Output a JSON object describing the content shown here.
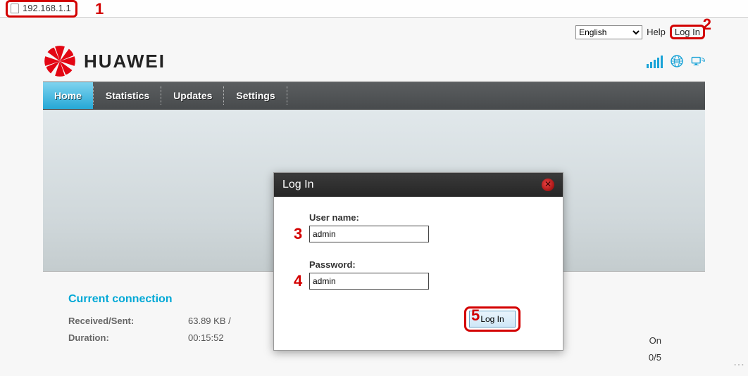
{
  "addressbar": {
    "url": "192.168.1.1"
  },
  "annotations": {
    "n1": "1",
    "n2": "2",
    "n3": "3",
    "n4": "4",
    "n5": "5"
  },
  "top": {
    "language_selected": "English",
    "help": "Help",
    "login": "Log In"
  },
  "brand": {
    "name": "HUAWEI"
  },
  "nav": {
    "items": [
      {
        "label": "Home",
        "active": true
      },
      {
        "label": "Statistics",
        "active": false
      },
      {
        "label": "Updates",
        "active": false
      },
      {
        "label": "Settings",
        "active": false
      }
    ]
  },
  "stats": {
    "title": "Current connection",
    "rows": [
      {
        "label": "Received/Sent:",
        "value": "63.89 KB /"
      },
      {
        "label": "Duration:",
        "value": "00:15:52"
      }
    ],
    "right": {
      "status": "On",
      "count": "0/5"
    }
  },
  "modal": {
    "title": "Log In",
    "username_label": "User name:",
    "username_value": "admin",
    "password_label": "Password:",
    "password_value": "admin",
    "submit_label": "Log In"
  }
}
